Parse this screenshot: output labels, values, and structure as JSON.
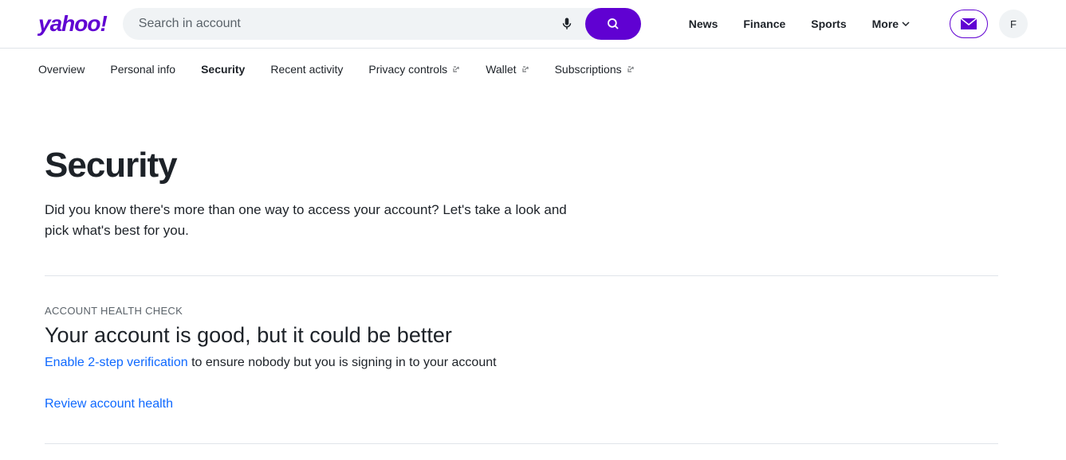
{
  "brand": "yahoo!",
  "search": {
    "placeholder": "Search in account"
  },
  "topnav": {
    "items": [
      "News",
      "Finance",
      "Sports"
    ],
    "more": "More"
  },
  "avatar_initial": "F",
  "subnav": {
    "items": [
      {
        "label": "Overview",
        "external": false
      },
      {
        "label": "Personal info",
        "external": false
      },
      {
        "label": "Security",
        "external": false
      },
      {
        "label": "Recent activity",
        "external": false
      },
      {
        "label": "Privacy controls",
        "external": true
      },
      {
        "label": "Wallet",
        "external": true
      },
      {
        "label": "Subscriptions",
        "external": true
      }
    ]
  },
  "page": {
    "title": "Security",
    "description": "Did you know there's more than one way to access your account? Let's take a look and pick what's best for you."
  },
  "health": {
    "label": "ACCOUNT HEALTH CHECK",
    "heading": "Your account is good, but it could be better",
    "link_text": "Enable 2-step verification",
    "rest_text": " to ensure nobody but you is signing in to your account",
    "review": "Review account health"
  }
}
